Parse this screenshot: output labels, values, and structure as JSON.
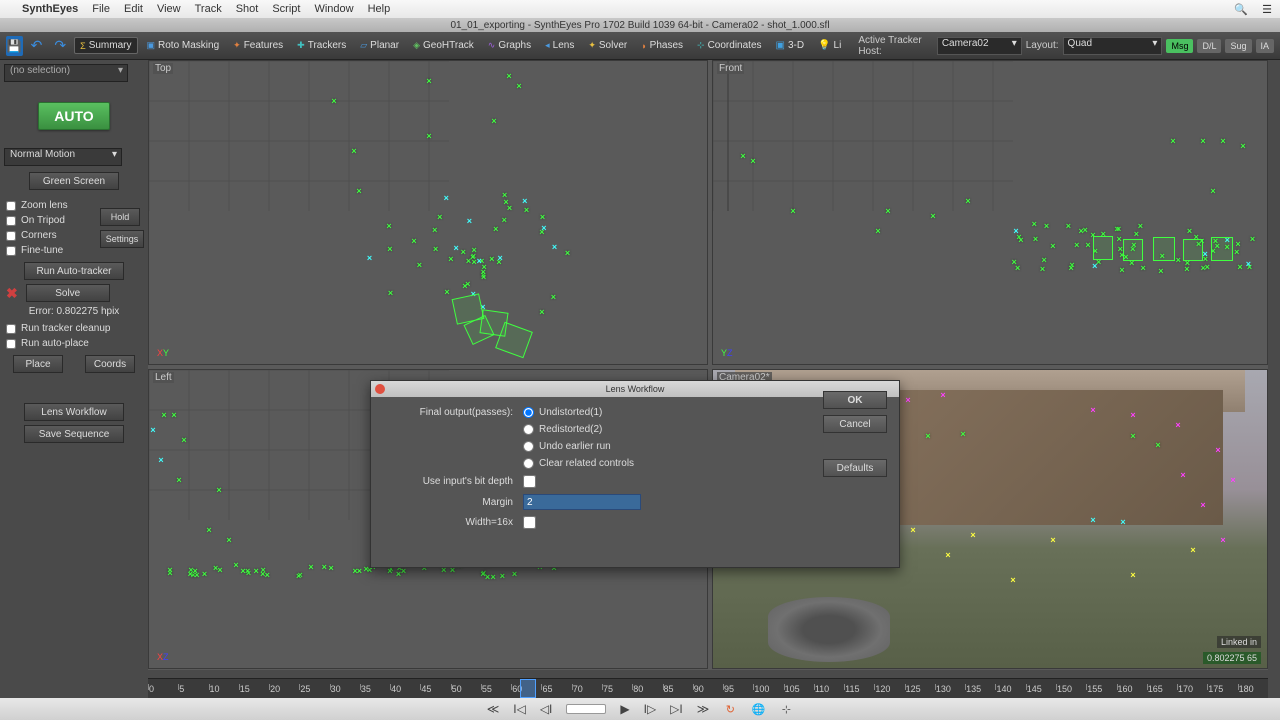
{
  "menubar": {
    "app": "SynthEyes",
    "items": [
      "File",
      "Edit",
      "View",
      "Track",
      "Shot",
      "Script",
      "Window",
      "Help"
    ]
  },
  "titlebar": "01_01_exporting - SynthEyes Pro 1702 Build 1039 64-bit - Camera02 - shot_1.000.sfl",
  "toolbar": {
    "items": [
      "Summary",
      "Roto Masking",
      "Features",
      "Trackers",
      "Planar",
      "GeoHTrack",
      "Graphs",
      "Lens",
      "Solver",
      "Phases",
      "Coordinates",
      "3-D",
      "Li"
    ],
    "selected": 0,
    "active_tracker_label": "Active Tracker Host:",
    "active_tracker_value": "Camera02",
    "layout_label": "Layout:",
    "layout_value": "Quad",
    "chips": [
      "Msg",
      "D/L",
      "Sug",
      "IA"
    ]
  },
  "sidebar": {
    "selection": "(no selection)",
    "auto": "AUTO",
    "motion": "Normal Motion",
    "green_screen": "Green Screen",
    "checks": [
      "Zoom lens",
      "On Tripod",
      "Corners",
      "Fine-tune"
    ],
    "hold": "Hold",
    "settings": "Settings",
    "run_auto": "Run Auto-tracker",
    "solve": "Solve",
    "error": "Error: 0.802275 hpix",
    "cleanup": "Run tracker cleanup",
    "autoplace": "Run auto-place",
    "place": "Place",
    "coords": "Coords",
    "lens_workflow": "Lens Workflow",
    "save_seq": "Save Sequence"
  },
  "viewports": {
    "tl": "Top",
    "tr": "Front",
    "bl": "Left",
    "br": "Camera02*"
  },
  "dialog": {
    "title": "Lens Workflow",
    "final_output_label": "Final output(passes):",
    "radios": [
      "Undistorted(1)",
      "Redistorted(2)",
      "Undo earlier run",
      "Clear related controls"
    ],
    "radio_selected": 0,
    "bitdepth": "Use input's bit depth",
    "margin_label": "Margin",
    "margin_value": "2",
    "width_label": "Width=16x",
    "ok": "OK",
    "cancel": "Cancel",
    "defaults": "Defaults"
  },
  "timeline": {
    "start": 0,
    "end": 180,
    "step": 5,
    "current": 65
  },
  "linked_badge": "Linked in",
  "frame_badge": "0.802275 65"
}
